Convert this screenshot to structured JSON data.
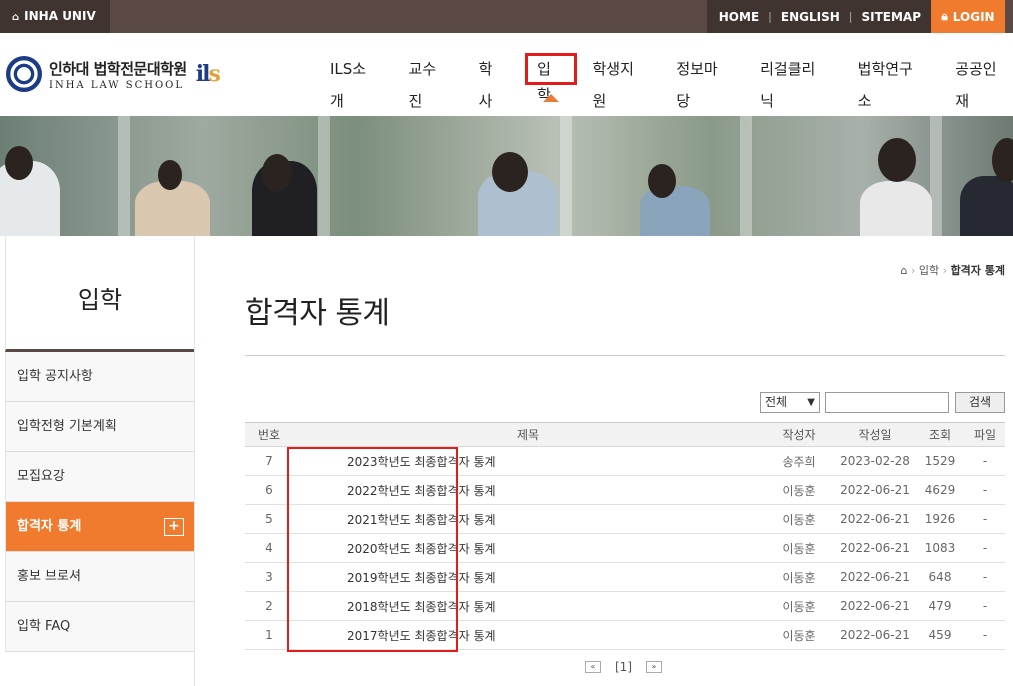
{
  "topbar": {
    "univ": "INHA UNIV",
    "links": [
      "HOME",
      "ENGLISH",
      "SITEMAP"
    ],
    "login": "LOGIN"
  },
  "logo": {
    "kr": "인하대 법학전문대학원",
    "en": "INHA LAW SCHOOL",
    "ils_main": "il",
    "ils_accent": "s"
  },
  "gnb": [
    "ILS소개",
    "교수진",
    "학사",
    "입학",
    "학생지원",
    "정보마당",
    "리걸클리닉",
    "법학연구소",
    "공공인재"
  ],
  "gnb_active": "입학",
  "sidebar": {
    "title": "입학",
    "items": [
      "입학 공지사항",
      "입학전형 기본계획",
      "모집요강",
      "합격자 통계",
      "홍보 브로셔",
      "입학 FAQ"
    ]
  },
  "breadcrumb": {
    "parent": "입학",
    "current": "합격자 통계"
  },
  "page_title": "합격자 통계",
  "search": {
    "select": "전체",
    "button": "검색"
  },
  "table": {
    "headers": [
      "번호",
      "제목",
      "작성자",
      "작성일",
      "조회",
      "파일"
    ],
    "rows": [
      [
        "7",
        "2023학년도 최종합격자 통계",
        "송주희",
        "2023-02-28",
        "1529",
        "-"
      ],
      [
        "6",
        "2022학년도 최종합격자 통계",
        "이동훈",
        "2022-06-21",
        "4629",
        "-"
      ],
      [
        "5",
        "2021학년도 최종합격자 통계",
        "이동훈",
        "2022-06-21",
        "1926",
        "-"
      ],
      [
        "4",
        "2020학년도 최종합격자 통계",
        "이동훈",
        "2022-06-21",
        "1083",
        "-"
      ],
      [
        "3",
        "2019학년도 최종합격자 통계",
        "이동훈",
        "2022-06-21",
        "648",
        "-"
      ],
      [
        "2",
        "2018학년도 최종합격자 통계",
        "이동훈",
        "2022-06-21",
        "479",
        "-"
      ],
      [
        "1",
        "2017학년도 최종합격자 통계",
        "이동훈",
        "2022-06-21",
        "459",
        "-"
      ]
    ]
  },
  "pager": {
    "first": "«",
    "current": "[1]",
    "last": "»"
  },
  "colors": {
    "accent": "#f07b2e",
    "topbar": "#5a4a43",
    "highlight": "#e21b1b"
  }
}
